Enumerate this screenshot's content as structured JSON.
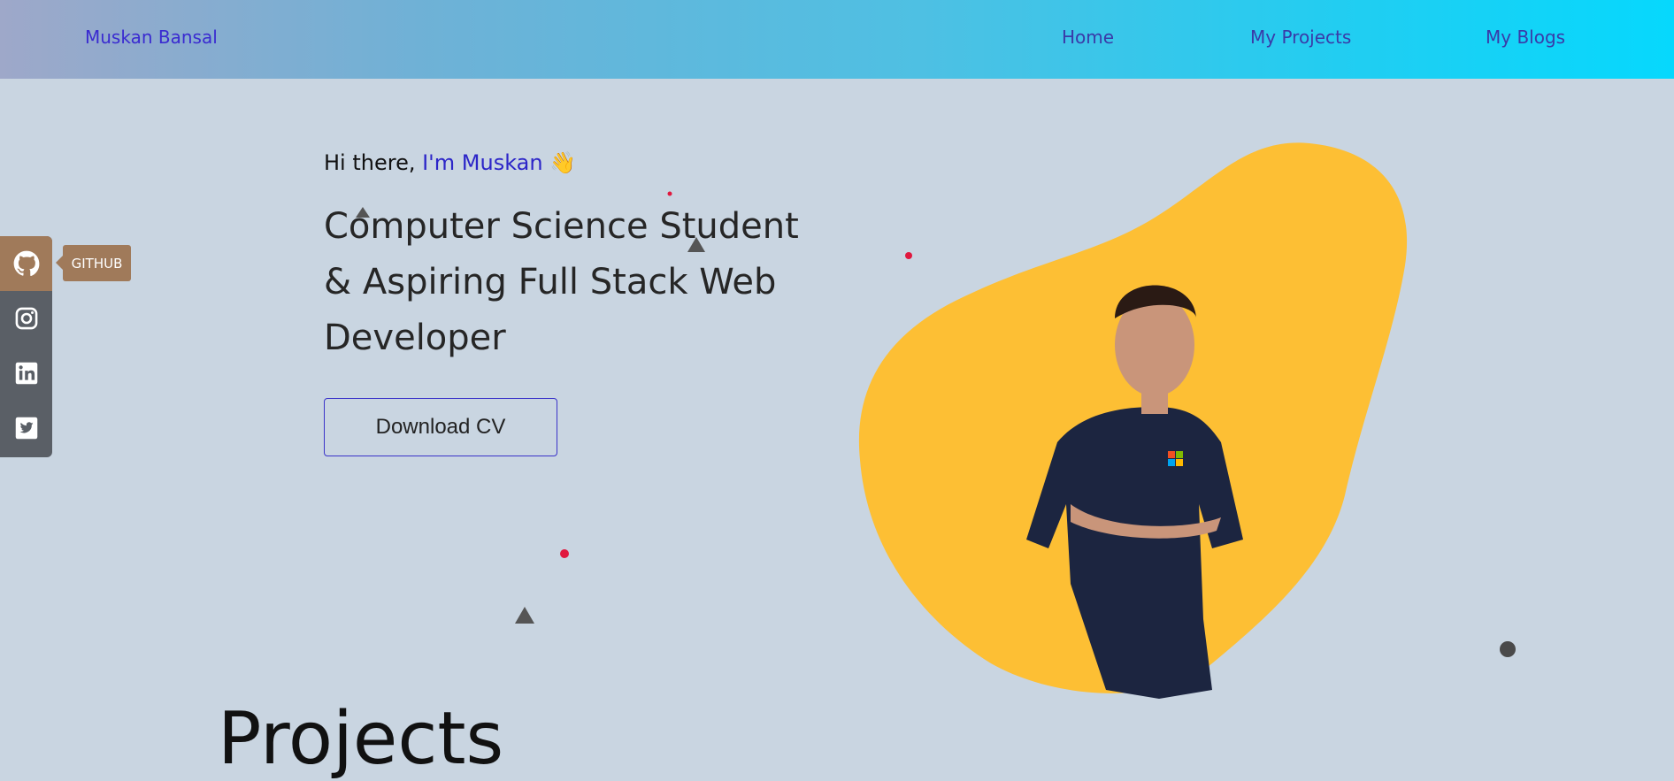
{
  "navbar": {
    "brand": "Muskan Bansal",
    "links": [
      "Home",
      "My Projects",
      "My Blogs"
    ]
  },
  "social": {
    "items": [
      {
        "icon": "github-icon",
        "label": "GITHUB"
      },
      {
        "icon": "instagram-icon"
      },
      {
        "icon": "linkedin-icon"
      },
      {
        "icon": "twitter-icon"
      }
    ],
    "tooltip": "GITHUB"
  },
  "hero": {
    "greeting_prefix": "Hi there, ",
    "greeting_name": "I'm Muskan",
    "wave_emoji": "👋",
    "headline": "Computer Science Student & Aspiring Full Stack Web Developer",
    "cta_label": "Download CV"
  },
  "sections": {
    "projects_heading": "Projects"
  },
  "colors": {
    "accent": "#2c25c8",
    "blob": "#fdbf34",
    "social_active": "#a07a5a",
    "background": "#c9d5e1"
  }
}
